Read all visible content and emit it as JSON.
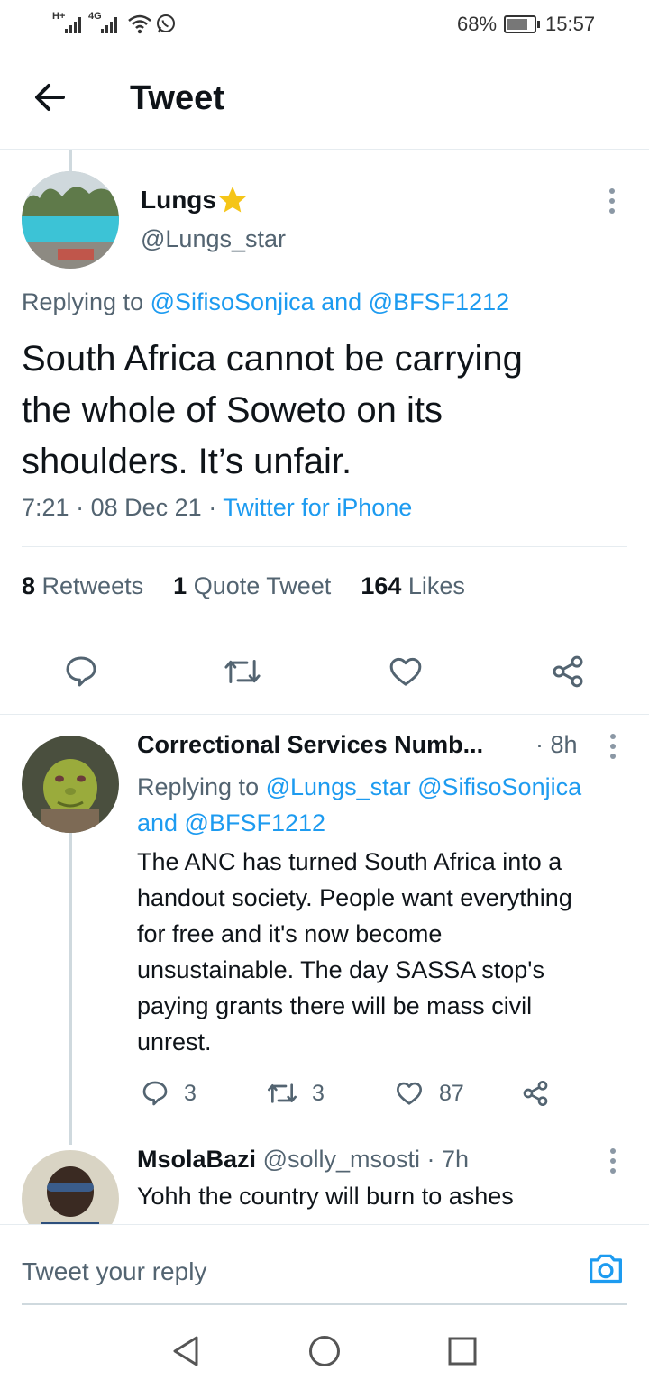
{
  "status_bar": {
    "signal1": "H+",
    "signal2": "4G",
    "battery_percent": "68%",
    "battery_level": 0.68,
    "time": "15:57"
  },
  "header": {
    "title": "Tweet"
  },
  "main_tweet": {
    "display_name": "Lungs",
    "handle": "@Lungs_star",
    "replying_prefix": "Replying to",
    "replying_to": "@SifisoSonjica and @BFSF1212",
    "text_line1": "South Africa cannot be carrying",
    "text_line2": "the whole of Soweto on its",
    "text_line3": "shoulders. It’s unfair.",
    "time": "7:21",
    "date": "08 Dec 21",
    "source": "Twitter for iPhone",
    "stats": {
      "retweets_count": "8",
      "retweets_label": "Retweets",
      "quotes_count": "1",
      "quotes_label": "Quote Tweet",
      "likes_count": "164",
      "likes_label": "Likes"
    }
  },
  "replies": [
    {
      "display_name": "Correctional Services Numb...",
      "time_ago": "· 8h",
      "replying_prefix": "Replying to",
      "replying_line1": "@Lungs_star @SifisoSonjica",
      "replying_line2": "and @BFSF1212",
      "text_lines": [
        "The ANC has turned South Africa into a",
        "handout society. People want everything",
        "for free and it's now become",
        "unsustainable. The day SASSA stop's",
        "paying grants there will be mass civil",
        "unrest."
      ],
      "reply_count": "3",
      "retweet_count": "3",
      "like_count": "87"
    },
    {
      "display_name": "MsolaBazi",
      "handle": "@solly_msosti",
      "time_ago": "· 7h",
      "text_line1": "Yohh the country will burn to ashes"
    }
  ],
  "reply_bar": {
    "placeholder": "Tweet your reply"
  },
  "colors": {
    "accent": "#1d9bf0",
    "muted": "#536471",
    "text": "#0f1419",
    "divider": "#e6ecf0",
    "star": "#f5c518"
  }
}
